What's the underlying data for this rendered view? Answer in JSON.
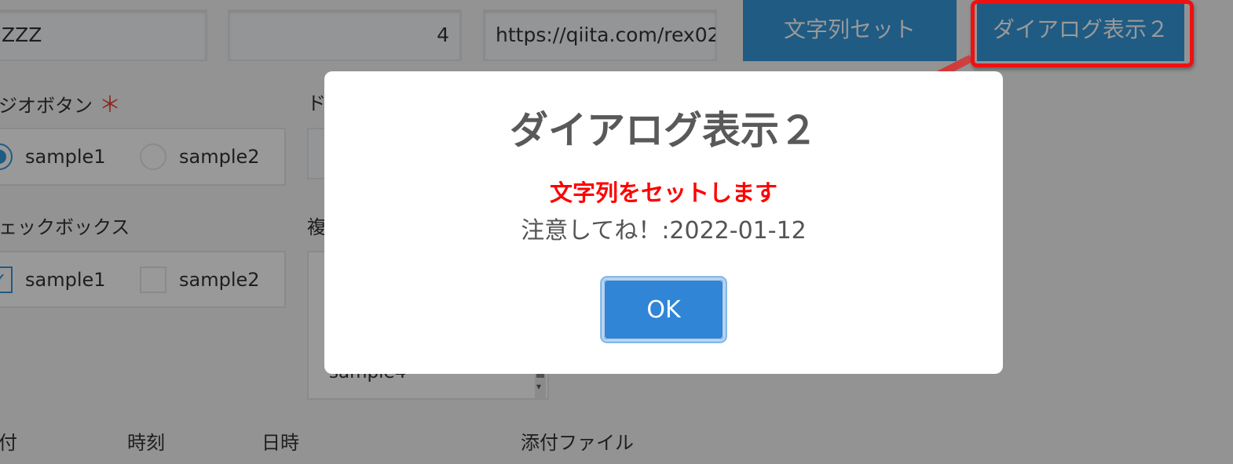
{
  "form": {
    "field_text": "ZZZ",
    "field_number": "4",
    "field_url": "https://qiita.com/rex02",
    "button_set_string": "文字列セット",
    "button_dialog2": "ダイアログ表示２",
    "radio_label": "ジオボタン",
    "radio_required_mark": "＊",
    "radio_options": [
      "sample1",
      "sample2"
    ],
    "radio_selected": "sample1",
    "dropdown_label": "ド",
    "checkbox_label": "ェックボックス",
    "checkbox_options": [
      "sample1",
      "sample2"
    ],
    "checkbox_checked": [
      "sample1"
    ],
    "multiselect_label": "複",
    "multiselect_item": "sample4",
    "date_label": "付",
    "time_label": "時刻",
    "datetime_label": "日時",
    "attachment_label": "添付ファイル"
  },
  "dialog": {
    "title": "ダイアログ表示２",
    "message_red": "文字列をセットします",
    "message": "注意してね！:2022-01-12",
    "ok_label": "OK"
  },
  "colors": {
    "kintone_blue": "#3498db",
    "dialog_ok": "#3085d6",
    "annotation_red": "#ee1111",
    "message_red": "#ff0000"
  }
}
